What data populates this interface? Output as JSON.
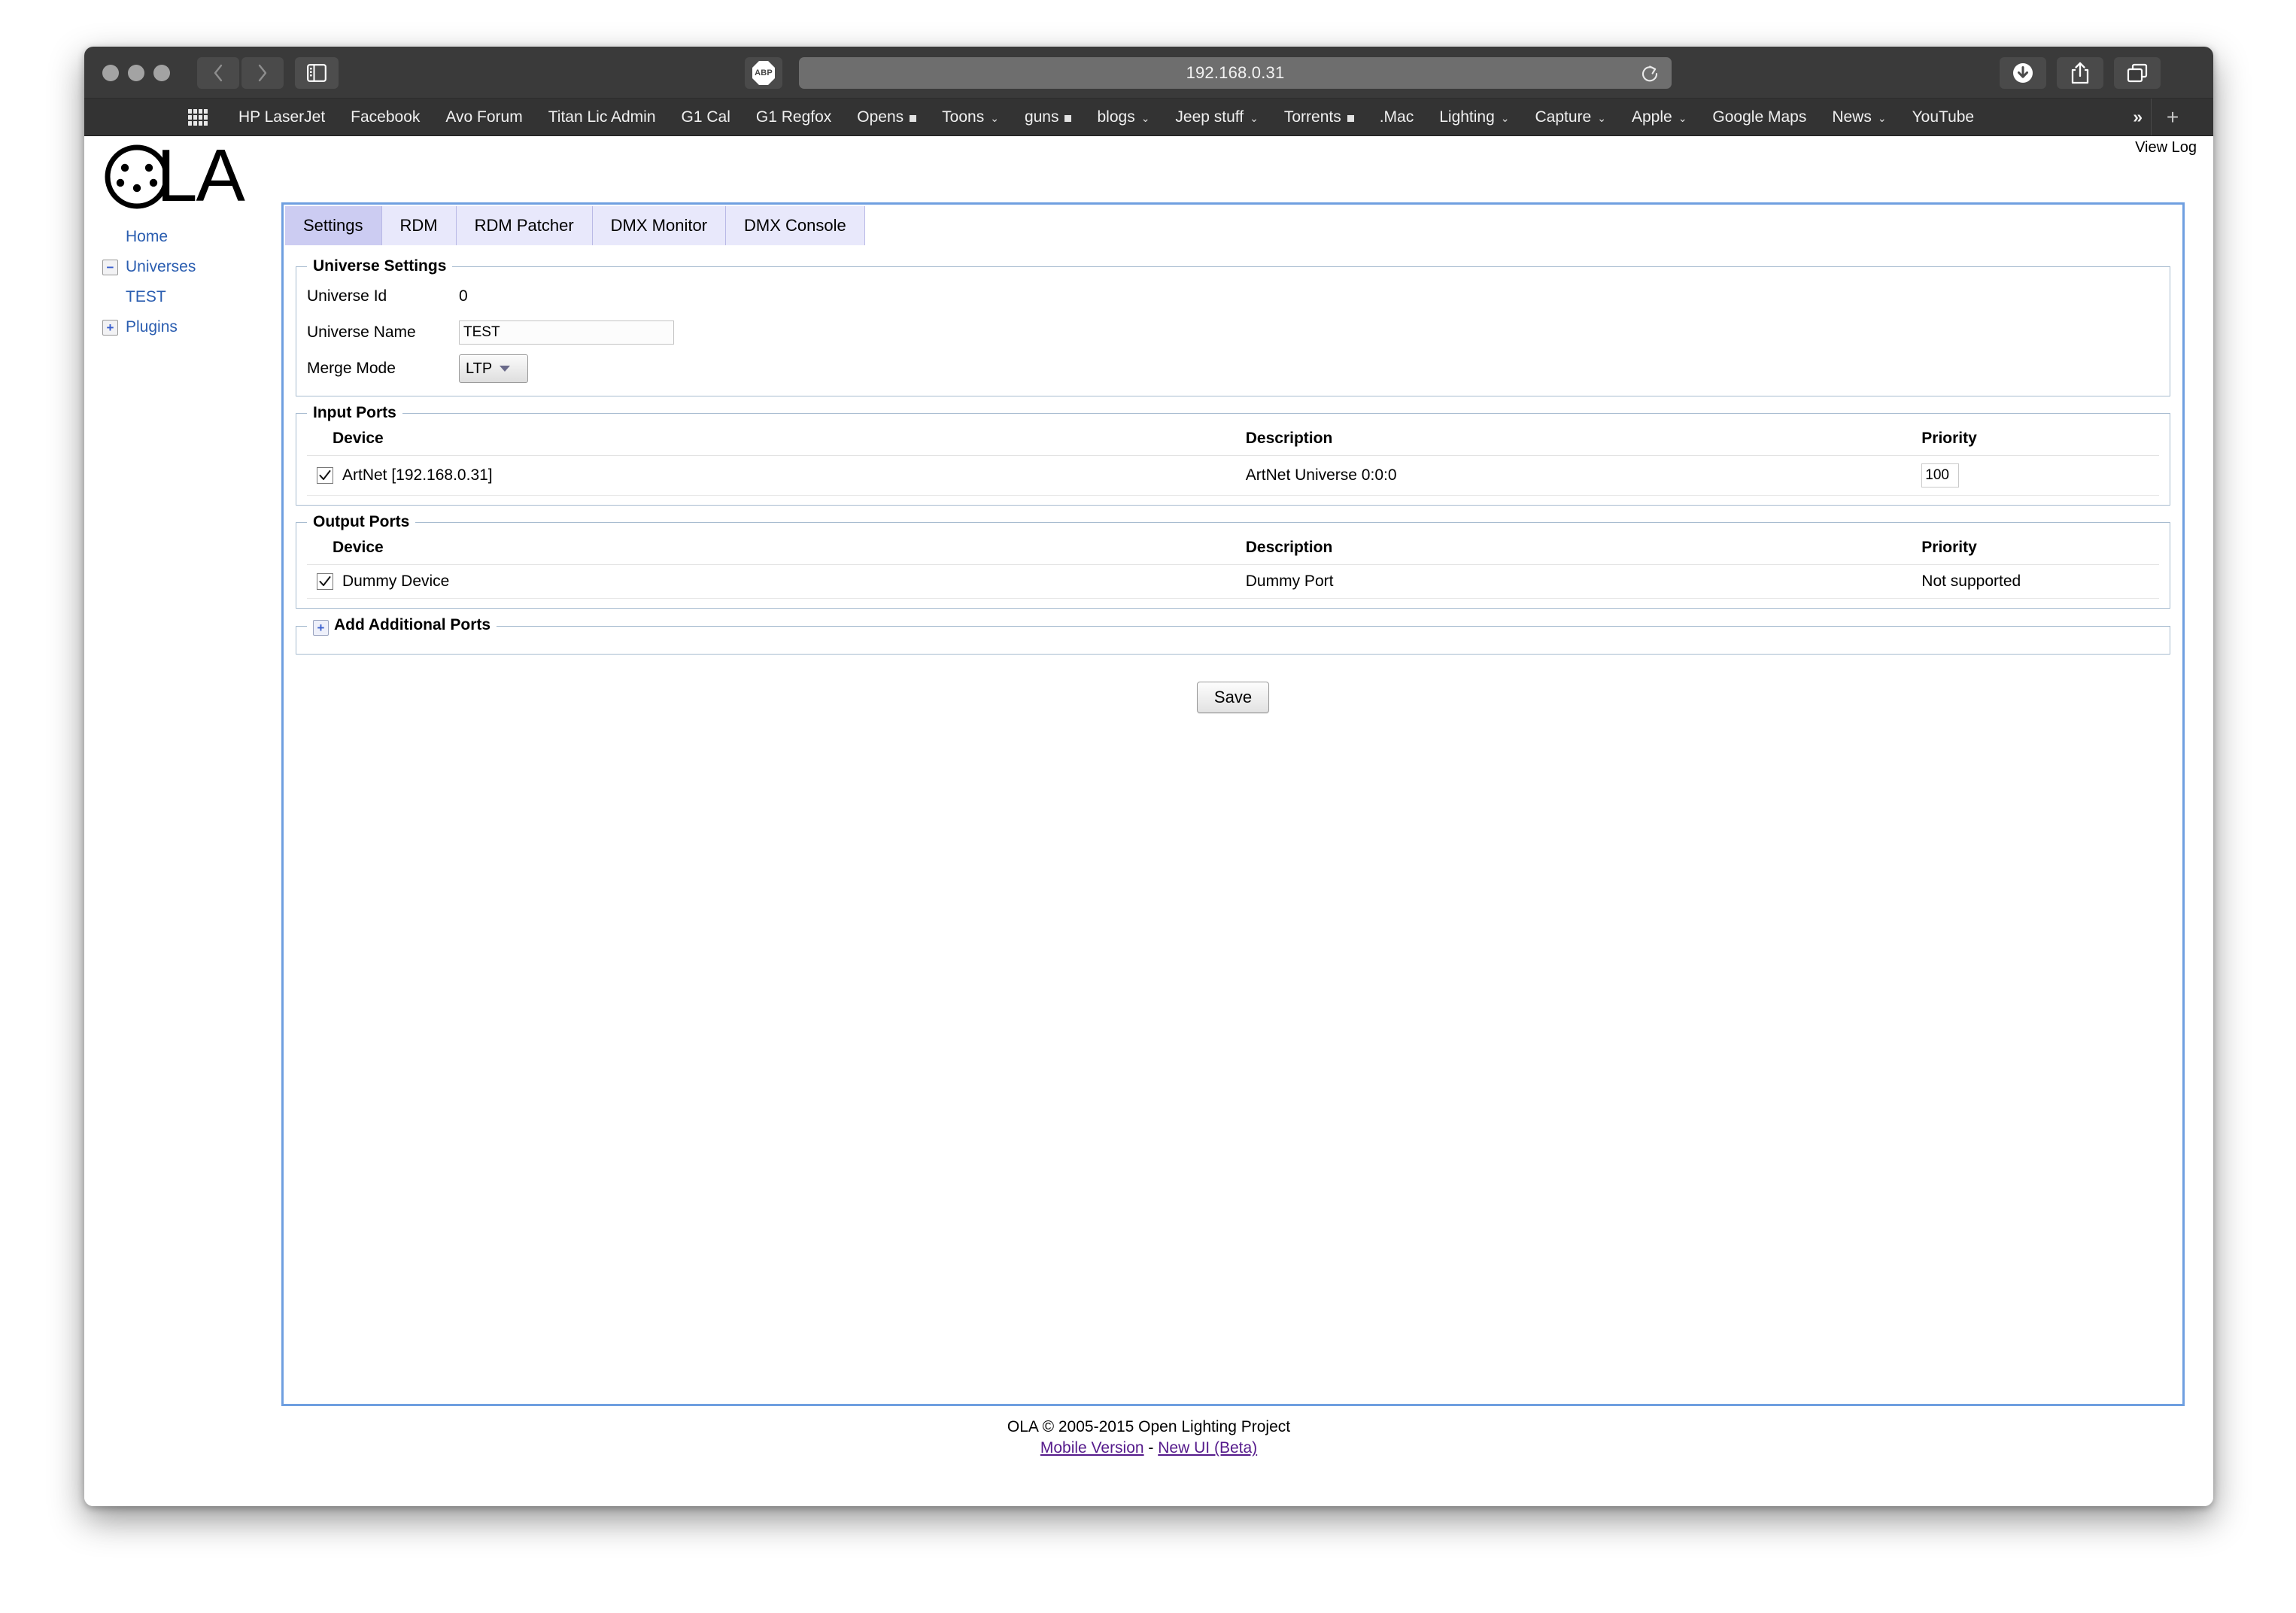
{
  "browser": {
    "url": "192.168.0.31",
    "abp_label": "ABP",
    "bookmarks": [
      {
        "label": "HP LaserJet",
        "marker": "none"
      },
      {
        "label": "Facebook",
        "marker": "none"
      },
      {
        "label": "Avo Forum",
        "marker": "none"
      },
      {
        "label": "Titan Lic Admin",
        "marker": "none"
      },
      {
        "label": "G1 Cal",
        "marker": "none"
      },
      {
        "label": "G1 Regfox",
        "marker": "none"
      },
      {
        "label": "Opens",
        "marker": "square"
      },
      {
        "label": "Toons",
        "marker": "caret"
      },
      {
        "label": "guns",
        "marker": "square"
      },
      {
        "label": "blogs",
        "marker": "caret"
      },
      {
        "label": "Jeep stuff",
        "marker": "caret"
      },
      {
        "label": "Torrents",
        "marker": "square"
      },
      {
        "label": ".Mac",
        "marker": "none"
      },
      {
        "label": "Lighting",
        "marker": "caret"
      },
      {
        "label": "Capture",
        "marker": "caret"
      },
      {
        "label": "Apple",
        "marker": "caret"
      },
      {
        "label": "Google Maps",
        "marker": "none"
      },
      {
        "label": "News",
        "marker": "caret"
      },
      {
        "label": "YouTube",
        "marker": "none"
      }
    ],
    "overflow_label": "»",
    "add_label": "+"
  },
  "page": {
    "view_log_label": "View Log",
    "logo_alt": "OLA",
    "logo_text": "LA"
  },
  "nav": {
    "items": [
      {
        "label": "Home",
        "toggle": ""
      },
      {
        "label": "Universes",
        "toggle": "−"
      },
      {
        "label": "TEST",
        "toggle": "",
        "indented": true
      },
      {
        "label": "Plugins",
        "toggle": "+"
      }
    ]
  },
  "tabs": [
    {
      "label": "Settings",
      "active": true
    },
    {
      "label": "RDM",
      "active": false
    },
    {
      "label": "RDM Patcher",
      "active": false
    },
    {
      "label": "DMX Monitor",
      "active": false
    },
    {
      "label": "DMX Console",
      "active": false
    }
  ],
  "universe_settings": {
    "legend": "Universe Settings",
    "universe_id_label": "Universe Id",
    "universe_id_value": "0",
    "universe_name_label": "Universe Name",
    "universe_name_value": "TEST",
    "merge_mode_label": "Merge Mode",
    "merge_mode_value": "LTP"
  },
  "input_ports": {
    "legend": "Input Ports",
    "headers": {
      "device": "Device",
      "description": "Description",
      "priority": "Priority"
    },
    "rows": [
      {
        "checked": true,
        "device": "ArtNet [192.168.0.31]",
        "description": "ArtNet Universe 0:0:0",
        "priority": "100",
        "priority_is_input": true
      }
    ]
  },
  "output_ports": {
    "legend": "Output Ports",
    "headers": {
      "device": "Device",
      "description": "Description",
      "priority": "Priority"
    },
    "rows": [
      {
        "checked": true,
        "device": "Dummy Device",
        "description": "Dummy Port",
        "priority": "Not supported",
        "priority_is_input": false
      }
    ]
  },
  "add_ports": {
    "legend": "Add Additional Ports",
    "toggle": "+"
  },
  "actions": {
    "save_label": "Save"
  },
  "footer": {
    "copyright": "OLA © 2005-2015 Open Lighting Project",
    "mobile_link": "Mobile Version",
    "separator": " - ",
    "newui_link": "New UI (Beta)"
  },
  "colors": {
    "tab_active": "#ccccf2",
    "tab_inactive": "#e8e8fb",
    "panel_border": "#6f9fe0",
    "link": "#2a5db0",
    "visited_link": "#551a8b",
    "toolbar_bg": "#3a3a3a",
    "bookmarks_bg": "#333333"
  }
}
